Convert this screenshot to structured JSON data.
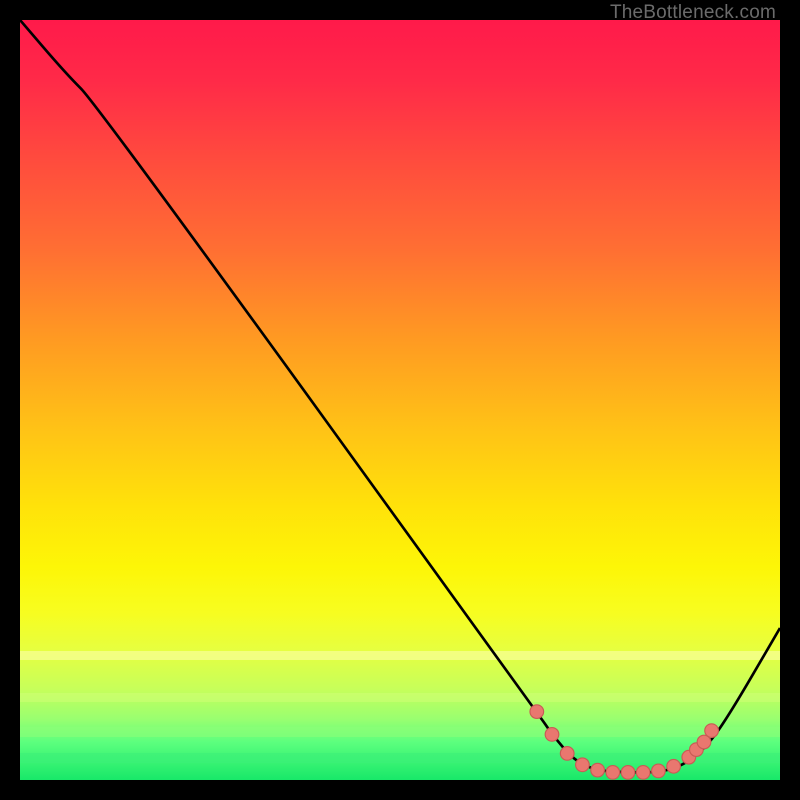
{
  "watermark": "TheBottleneck.com",
  "colors": {
    "page_bg": "#000000",
    "curve_stroke": "#000000",
    "marker_fill": "#e9776f",
    "marker_stroke": "#c95b55"
  },
  "chart_data": {
    "type": "line",
    "title": "",
    "xlabel": "",
    "ylabel": "",
    "xlim": [
      0,
      100
    ],
    "ylim": [
      0,
      100
    ],
    "grid": false,
    "legend": false,
    "curve": [
      {
        "x": 0,
        "y": 100
      },
      {
        "x": 6,
        "y": 93
      },
      {
        "x": 10,
        "y": 89
      },
      {
        "x": 68,
        "y": 9
      },
      {
        "x": 70,
        "y": 6
      },
      {
        "x": 73,
        "y": 2.5
      },
      {
        "x": 76,
        "y": 1.2
      },
      {
        "x": 80,
        "y": 1.0
      },
      {
        "x": 84,
        "y": 1.0
      },
      {
        "x": 87,
        "y": 1.8
      },
      {
        "x": 90,
        "y": 4
      },
      {
        "x": 93,
        "y": 8
      },
      {
        "x": 100,
        "y": 20
      }
    ],
    "markers": [
      {
        "x": 68,
        "y": 9
      },
      {
        "x": 70,
        "y": 6
      },
      {
        "x": 72,
        "y": 3.5
      },
      {
        "x": 74,
        "y": 2.0
      },
      {
        "x": 76,
        "y": 1.3
      },
      {
        "x": 78,
        "y": 1.0
      },
      {
        "x": 80,
        "y": 1.0
      },
      {
        "x": 82,
        "y": 1.0
      },
      {
        "x": 84,
        "y": 1.2
      },
      {
        "x": 86,
        "y": 1.8
      },
      {
        "x": 88,
        "y": 3.0
      },
      {
        "x": 89,
        "y": 4.0
      },
      {
        "x": 90,
        "y": 5.0
      },
      {
        "x": 91,
        "y": 6.5
      }
    ]
  }
}
